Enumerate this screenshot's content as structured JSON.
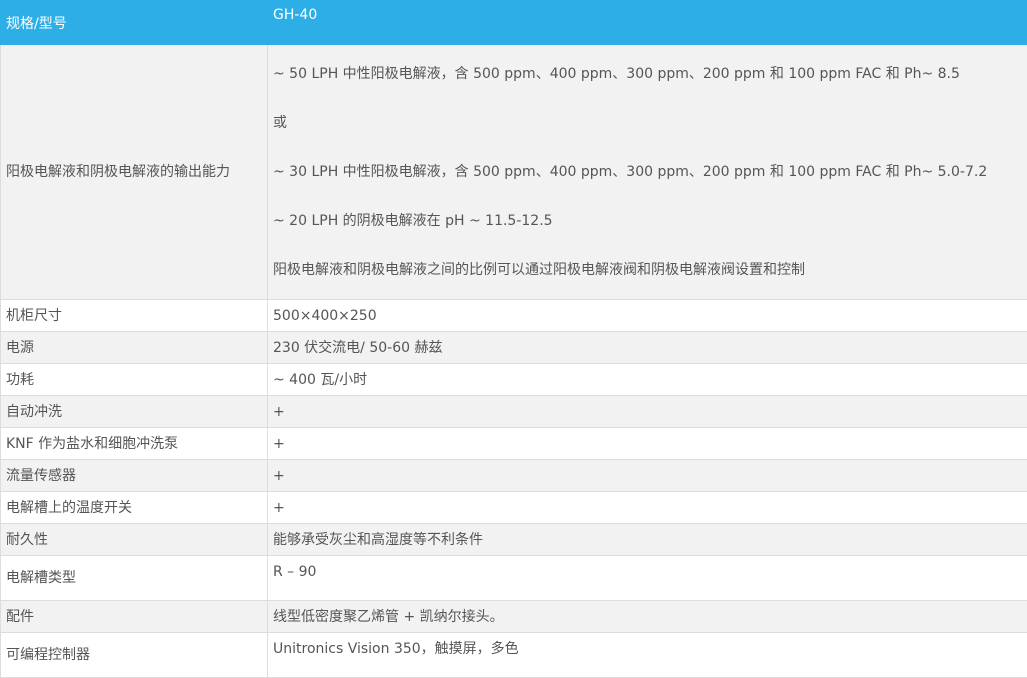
{
  "header": {
    "spec_label": "规格/型号",
    "model_value": "GH-40"
  },
  "rows": [
    {
      "label": "阳极电解液和阴极电解液的输出能力",
      "lines": [
        "~ 50 LPH 中性阳极电解液，含 500 ppm、400 ppm、300 ppm、200 ppm 和 100 ppm FAC 和 Ph~ 8.5",
        "或",
        "~ 30 LPH 中性阳极电解液，含 500 ppm、400 ppm、300 ppm、200 ppm 和 100 ppm FAC 和 Ph~ 5.0-7.2",
        "~ 20 LPH 的阴极电解液在 pH ~ 11.5-12.5",
        "阳极电解液和阴极电解液之间的比例可以通过阳极电解液阀和阴极电解液阀设置和控制"
      ]
    },
    {
      "label": "机柜尺寸",
      "value": "500×400×250"
    },
    {
      "label": "电源",
      "value": "230 伏交流电/ 50-60 赫兹"
    },
    {
      "label": "功耗",
      "value": "~ 400 瓦/小时"
    },
    {
      "label": "自动冲洗",
      "value": "+"
    },
    {
      "label": "KNF 作为盐水和细胞冲洗泵",
      "value": "+"
    },
    {
      "label": "流量传感器",
      "value": "+"
    },
    {
      "label": "电解槽上的温度开关",
      "value": "+"
    },
    {
      "label": "耐久性",
      "value": "能够承受灰尘和高湿度等不利条件"
    },
    {
      "label": "电解槽类型",
      "value": "R – 90"
    },
    {
      "label": "配件",
      "value": "线型低密度聚乙烯管 + 凯纳尔接头。"
    },
    {
      "label": "可编程控制器",
      "value": "Unitronics Vision 350，触摸屏，多色"
    }
  ],
  "colors": {
    "header_bg": "#2eaee6",
    "header_text": "#ffffff",
    "row_alt_bg": "#f2f2f2",
    "border": "#dddddd",
    "text": "#555555"
  }
}
